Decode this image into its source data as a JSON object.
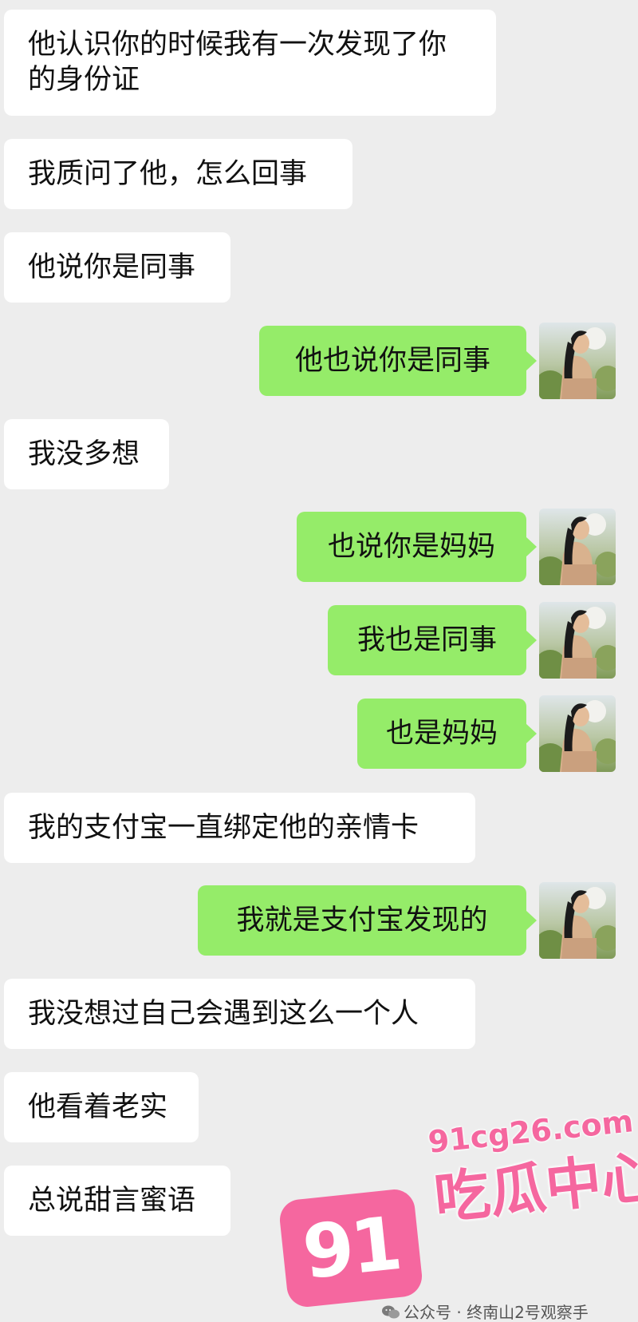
{
  "messages": [
    {
      "side": "left",
      "text": "他认识你的时候我有一次发现了你的身份证"
    },
    {
      "side": "left",
      "text": "我质问了他，怎么回事"
    },
    {
      "side": "left",
      "text": "他说你是同事"
    },
    {
      "side": "right",
      "text": "他也说你是同事"
    },
    {
      "side": "left",
      "text": "我没多想"
    },
    {
      "side": "right",
      "text": "也说你是妈妈"
    },
    {
      "side": "right",
      "text": "我也是同事"
    },
    {
      "side": "right",
      "text": "也是妈妈"
    },
    {
      "side": "left",
      "text": "我的支付宝一直绑定他的亲情卡"
    },
    {
      "side": "right",
      "text": "我就是支付宝发现的"
    },
    {
      "side": "left",
      "text": "我没想过自己会遇到这么一个人"
    },
    {
      "side": "left",
      "text": "他看着老实"
    },
    {
      "side": "left",
      "text": "总说甜言蜜语"
    }
  ],
  "watermark": {
    "number": "91",
    "site": "91cg26.com",
    "name": "吃瓜中心",
    "footer": "公众号 · 终南山2号观察手",
    "footer_icon": "wechat-icon",
    "color": "#f5679f"
  },
  "colors": {
    "background": "#ededed",
    "incoming_bubble": "#ffffff",
    "outgoing_bubble": "#95ec69"
  },
  "avatar_icon": "user-avatar-photo"
}
